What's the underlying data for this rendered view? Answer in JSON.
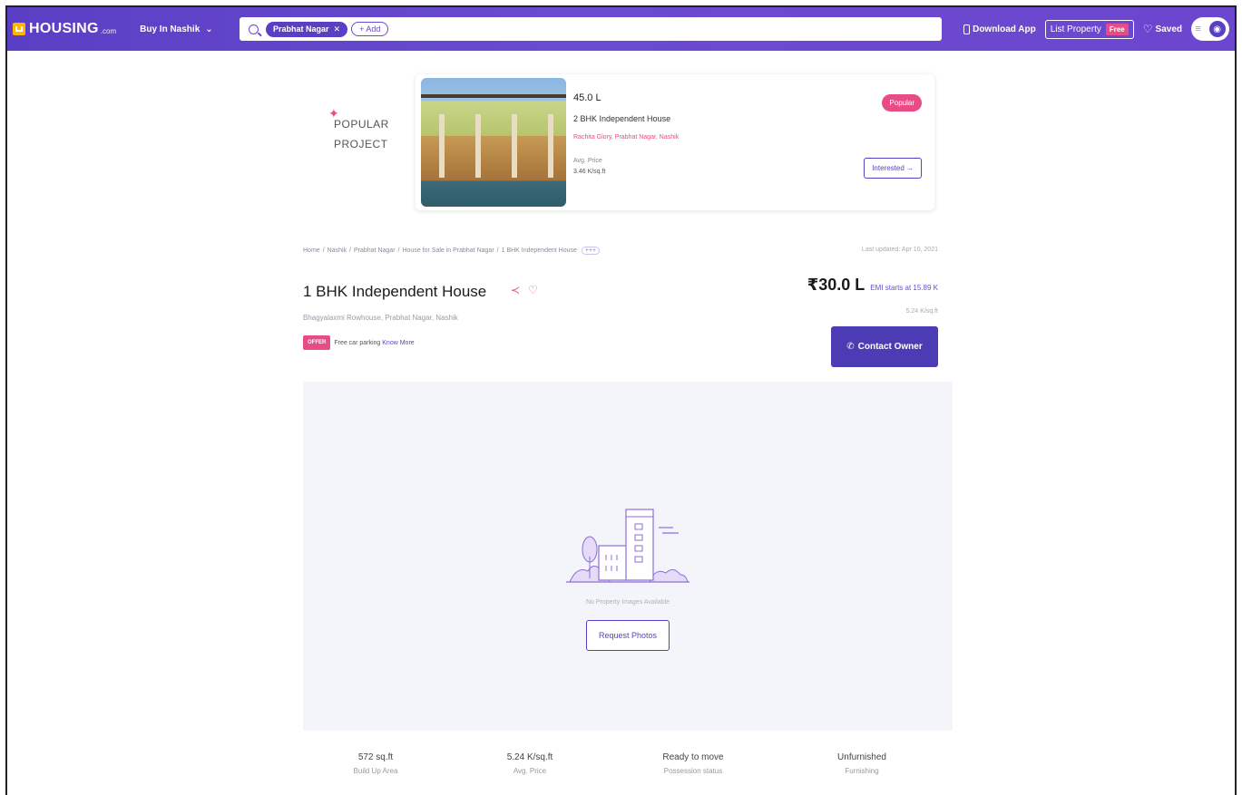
{
  "header": {
    "brand": "HOUSING",
    "brand_suffix": ".com",
    "city_select": "Buy In Nashik",
    "search_chip": "Prabhat Nagar",
    "add_chip": "+ Add",
    "download_app": "Download App",
    "list_property": "List Property",
    "free_badge": "Free",
    "saved": "Saved"
  },
  "popular_project": {
    "label_line1": "POPULAR",
    "label_line2": "PROJECT",
    "price": "45.0 L",
    "type": "2 BHK Independent House",
    "location": "Rachita Glory, Prabhat Nagar, Nashik",
    "avg_price_label": "Avg. Price",
    "avg_price": "3.46 K/sq.ft",
    "badge": "Popular",
    "cta": "Interested →"
  },
  "listing": {
    "breadcrumb": [
      "Home",
      "Nashik",
      "Prabhat Nagar",
      "House for Sale in Prabhat Nagar",
      "1 BHK Independent House"
    ],
    "breadcrumb_more": "+++",
    "last_updated": "Last updated: Apr 10, 2021",
    "title": "1 BHK Independent House",
    "address": "Bhagyalaxmi Rowhouse, Prabhat Nagar, Nashik",
    "offer_badge": "OFFER",
    "offer_text": "Free car parking",
    "offer_link": "Know More",
    "price": "₹30.0 L",
    "emi": "EMI starts at 15.89 K",
    "per_sqft": "5.24 K/sq.ft",
    "contact_button": "Contact Owner"
  },
  "gallery": {
    "empty_text": "No Property Images Available",
    "request_button": "Request Photos"
  },
  "facts": [
    {
      "value": "572 sq.ft",
      "label": "Build Up Area"
    },
    {
      "value": "5.24 K/sq.ft",
      "label": "Avg. Price"
    },
    {
      "value": "Ready to move",
      "label": "Possession status"
    },
    {
      "value": "Unfurnished",
      "label": "Furnishing"
    }
  ],
  "colors": {
    "brand_purple": "#5a3fc4",
    "accent_pink": "#e94b87",
    "contact_button": "#4b3bb5"
  }
}
